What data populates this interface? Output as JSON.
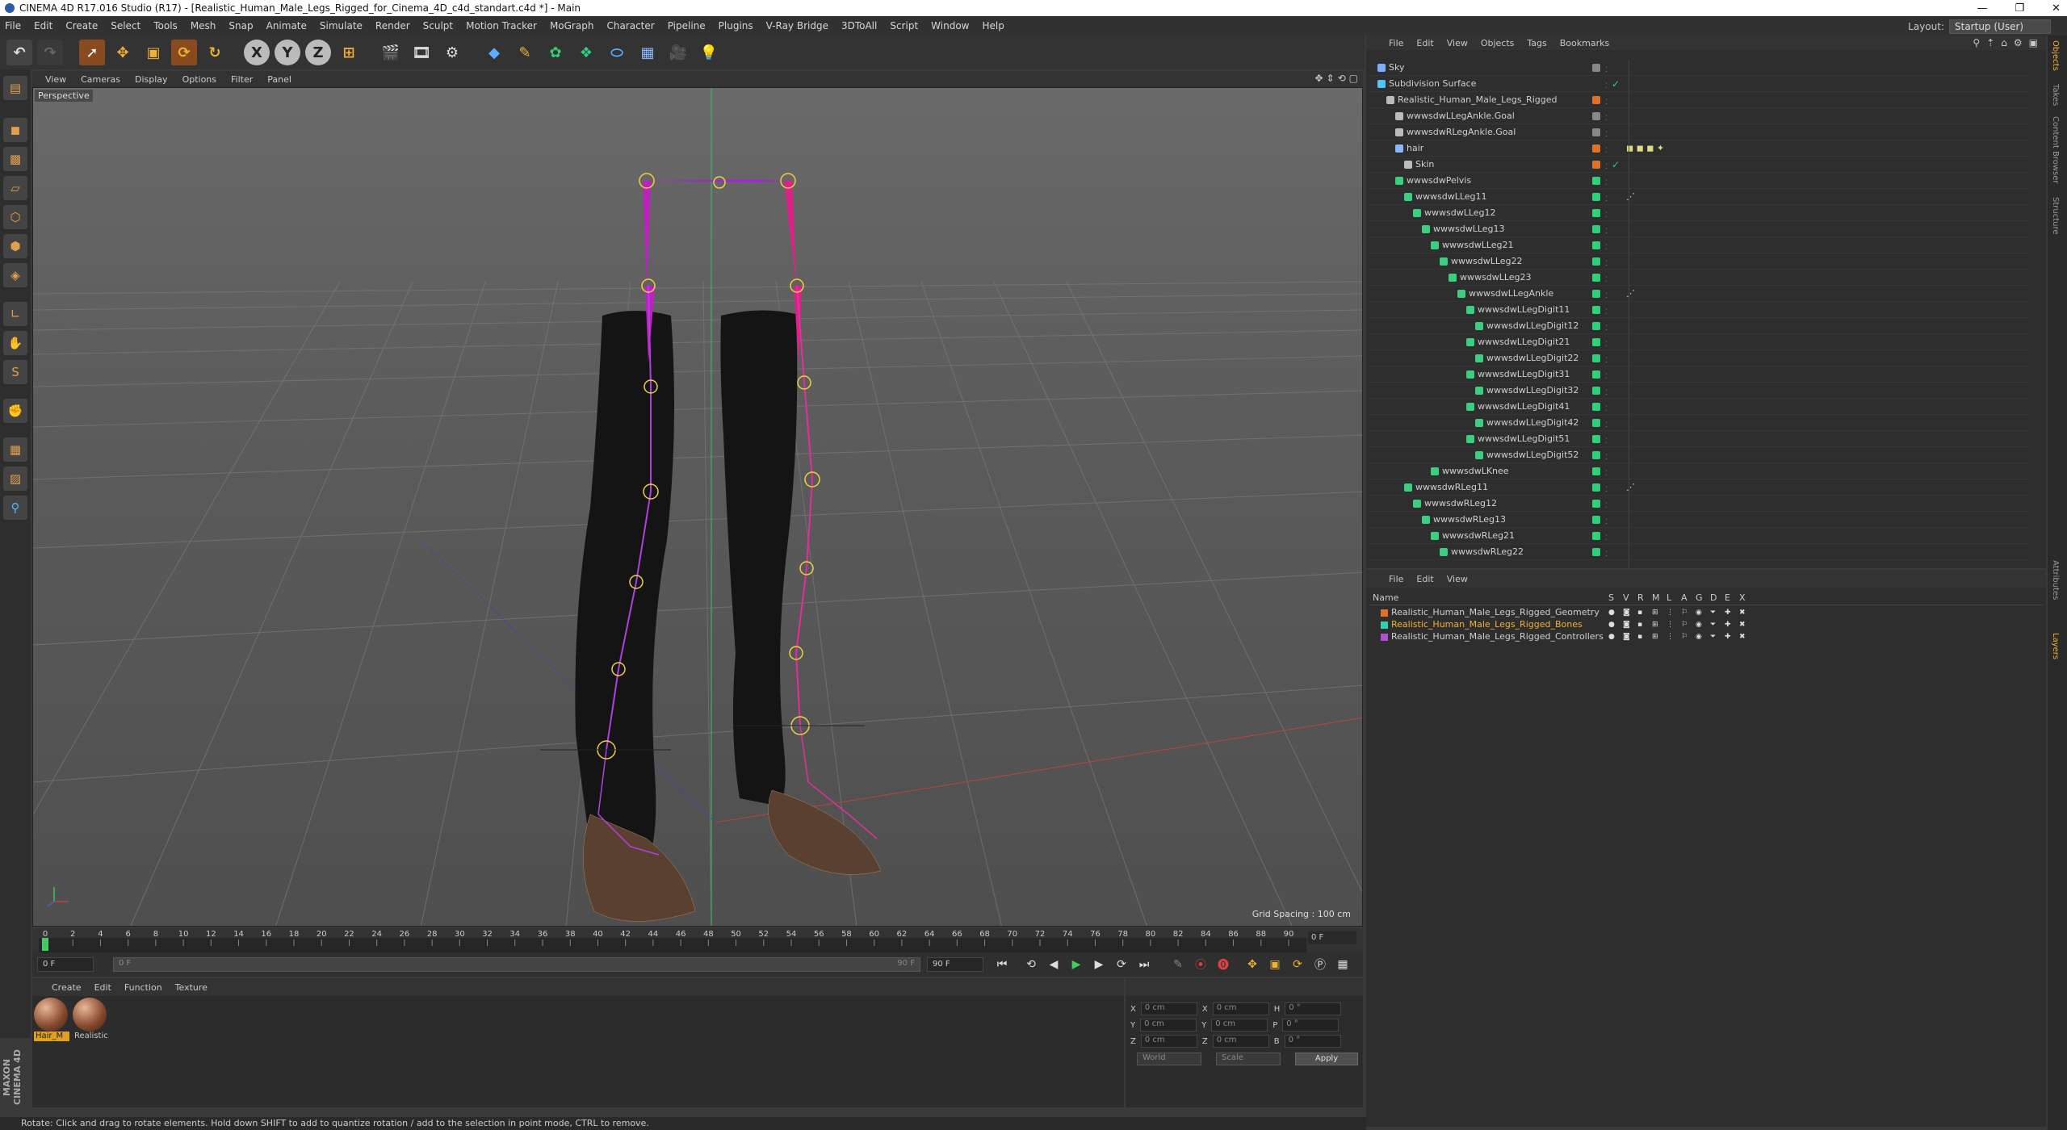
{
  "window": {
    "title": "CINEMA 4D R17.016 Studio (R17) - [Realistic_Human_Male_Legs_Rigged_for_Cinema_4D_c4d_standart.c4d *] - Main"
  },
  "menu": [
    "File",
    "Edit",
    "Create",
    "Select",
    "Tools",
    "Mesh",
    "Snap",
    "Animate",
    "Simulate",
    "Render",
    "Sculpt",
    "Motion Tracker",
    "MoGraph",
    "Character",
    "Pipeline",
    "Plugins",
    "V-Ray Bridge",
    "3DToAll",
    "Script",
    "Window",
    "Help"
  ],
  "layout": {
    "label": "Layout:",
    "value": "Startup (User)"
  },
  "viewport": {
    "menu": [
      "View",
      "Cameras",
      "Display",
      "Options",
      "Filter",
      "Panel"
    ],
    "label": "Perspective",
    "grid_spacing": "Grid Spacing : 100 cm"
  },
  "timeline": {
    "ticks": [
      "0",
      "2",
      "4",
      "6",
      "8",
      "10",
      "12",
      "14",
      "16",
      "18",
      "20",
      "22",
      "24",
      "26",
      "28",
      "30",
      "32",
      "34",
      "36",
      "38",
      "40",
      "42",
      "44",
      "46",
      "48",
      "50",
      "52",
      "54",
      "56",
      "58",
      "60",
      "62",
      "64",
      "66",
      "68",
      "70",
      "72",
      "74",
      "76",
      "78",
      "80",
      "82",
      "84",
      "86",
      "88",
      "90"
    ],
    "current": "0 F",
    "start": "0 F",
    "end": "90 F",
    "range_start": "0 F",
    "range_end": "90 F"
  },
  "material_manager": {
    "menu": [
      "Create",
      "Edit",
      "Function",
      "Texture"
    ],
    "materials": [
      {
        "label": "Hair_M"
      },
      {
        "label": "Realistic"
      }
    ]
  },
  "coordinates": {
    "rows": [
      {
        "a": "X",
        "av": "0 cm",
        "b": "X",
        "bv": "0 cm",
        "c": "H",
        "cv": "0 °"
      },
      {
        "a": "Y",
        "av": "0 cm",
        "b": "Y",
        "bv": "0 cm",
        "c": "P",
        "cv": "0 °"
      },
      {
        "a": "Z",
        "av": "0 cm",
        "b": "Z",
        "bv": "0 cm",
        "c": "B",
        "cv": "0 °"
      }
    ],
    "mode1": "World",
    "mode2": "Scale",
    "apply": "Apply"
  },
  "status": "Rotate: Click and drag to rotate elements. Hold down SHIFT to add to quantize rotation / add to the selection in point mode, CTRL to remove.",
  "brand": "MAXON CINEMA 4D",
  "object_manager": {
    "menu": [
      "File",
      "Edit",
      "View",
      "Objects",
      "Tags",
      "Bookmarks"
    ],
    "rows": [
      {
        "name": "Sky",
        "depth": 0,
        "icon": "#7ab0ff",
        "tag": "#888"
      },
      {
        "name": "Subdivision Surface",
        "depth": 0,
        "icon": "#55c0ff",
        "tag": "",
        "check": "✓"
      },
      {
        "name": "Realistic_Human_Male_Legs_Rigged",
        "depth": 1,
        "icon": "#bbb",
        "tag": "#e0702a"
      },
      {
        "name": "wwwsdwLLegAnkle.Goal",
        "depth": 2,
        "icon": "#bbb",
        "tag": "#888"
      },
      {
        "name": "wwwsdwRLegAnkle.Goal",
        "depth": 2,
        "icon": "#bbb",
        "tag": "#888"
      },
      {
        "name": "hair",
        "depth": 2,
        "icon": "#8ab8ff",
        "tag": "#e0702a",
        "extra": "◼ ◼ ◼ ✦"
      },
      {
        "name": "Skin",
        "depth": 3,
        "icon": "#bbb",
        "tag": "#e0702a",
        "check": "✓"
      },
      {
        "name": "wwwsdwPelvis",
        "depth": 2,
        "icon": "#3ad080",
        "tag": "#2ed07a"
      },
      {
        "name": "wwwsdwLLeg11",
        "depth": 3,
        "icon": "#3ad080",
        "tag": "#2ed07a",
        "extra": "⋰"
      },
      {
        "name": "wwwsdwLLeg12",
        "depth": 4,
        "icon": "#3ad080",
        "tag": "#2ed07a"
      },
      {
        "name": "wwwsdwLLeg13",
        "depth": 5,
        "icon": "#3ad080",
        "tag": "#2ed07a"
      },
      {
        "name": "wwwsdwLLeg21",
        "depth": 6,
        "icon": "#3ad080",
        "tag": "#2ed07a"
      },
      {
        "name": "wwwsdwLLeg22",
        "depth": 7,
        "icon": "#3ad080",
        "tag": "#2ed07a"
      },
      {
        "name": "wwwsdwLLeg23",
        "depth": 8,
        "icon": "#3ad080",
        "tag": "#2ed07a"
      },
      {
        "name": "wwwsdwLLegAnkle",
        "depth": 9,
        "icon": "#3ad080",
        "tag": "#2ed07a",
        "extra": "⋰"
      },
      {
        "name": "wwwsdwLLegDigit11",
        "depth": 10,
        "icon": "#3ad080",
        "tag": "#2ed07a"
      },
      {
        "name": "wwwsdwLLegDigit12",
        "depth": 11,
        "icon": "#3ad080",
        "tag": "#2ed07a"
      },
      {
        "name": "wwwsdwLLegDigit21",
        "depth": 10,
        "icon": "#3ad080",
        "tag": "#2ed07a"
      },
      {
        "name": "wwwsdwLLegDigit22",
        "depth": 11,
        "icon": "#3ad080",
        "tag": "#2ed07a"
      },
      {
        "name": "wwwsdwLLegDigit31",
        "depth": 10,
        "icon": "#3ad080",
        "tag": "#2ed07a"
      },
      {
        "name": "wwwsdwLLegDigit32",
        "depth": 11,
        "icon": "#3ad080",
        "tag": "#2ed07a"
      },
      {
        "name": "wwwsdwLLegDigit41",
        "depth": 10,
        "icon": "#3ad080",
        "tag": "#2ed07a"
      },
      {
        "name": "wwwsdwLLegDigit42",
        "depth": 11,
        "icon": "#3ad080",
        "tag": "#2ed07a"
      },
      {
        "name": "wwwsdwLLegDigit51",
        "depth": 10,
        "icon": "#3ad080",
        "tag": "#2ed07a"
      },
      {
        "name": "wwwsdwLLegDigit52",
        "depth": 11,
        "icon": "#3ad080",
        "tag": "#2ed07a"
      },
      {
        "name": "wwwsdwLKnee",
        "depth": 6,
        "icon": "#3ad080",
        "tag": "#2ed07a"
      },
      {
        "name": "wwwsdwRLeg11",
        "depth": 3,
        "icon": "#3ad080",
        "tag": "#2ed07a",
        "extra": "⋰"
      },
      {
        "name": "wwwsdwRLeg12",
        "depth": 4,
        "icon": "#3ad080",
        "tag": "#2ed07a"
      },
      {
        "name": "wwwsdwRLeg13",
        "depth": 5,
        "icon": "#3ad080",
        "tag": "#2ed07a"
      },
      {
        "name": "wwwsdwRLeg21",
        "depth": 6,
        "icon": "#3ad080",
        "tag": "#2ed07a"
      },
      {
        "name": "wwwsdwRLeg22",
        "depth": 7,
        "icon": "#3ad080",
        "tag": "#2ed07a"
      }
    ]
  },
  "layer_manager": {
    "menu": [
      "File",
      "Edit",
      "View"
    ],
    "header": {
      "name": "Name",
      "cols": [
        "S",
        "V",
        "R",
        "M",
        "L",
        "A",
        "G",
        "D",
        "E",
        "X"
      ]
    },
    "rows": [
      {
        "name": "Realistic_Human_Male_Legs_Rigged_Geometry",
        "color": "#e0702a",
        "text": "#cfcfcf"
      },
      {
        "name": "Realistic_Human_Male_Legs_Rigged_Bones",
        "color": "#2ed0b0",
        "text": "#f0b030"
      },
      {
        "name": "Realistic_Human_Male_Legs_Rigged_Controllers",
        "color": "#b050d0",
        "text": "#cfcfcf"
      }
    ]
  },
  "right_tabs": [
    "Objects",
    "Takes",
    "Content Browser",
    "Structure",
    "Attributes",
    "Layers"
  ]
}
